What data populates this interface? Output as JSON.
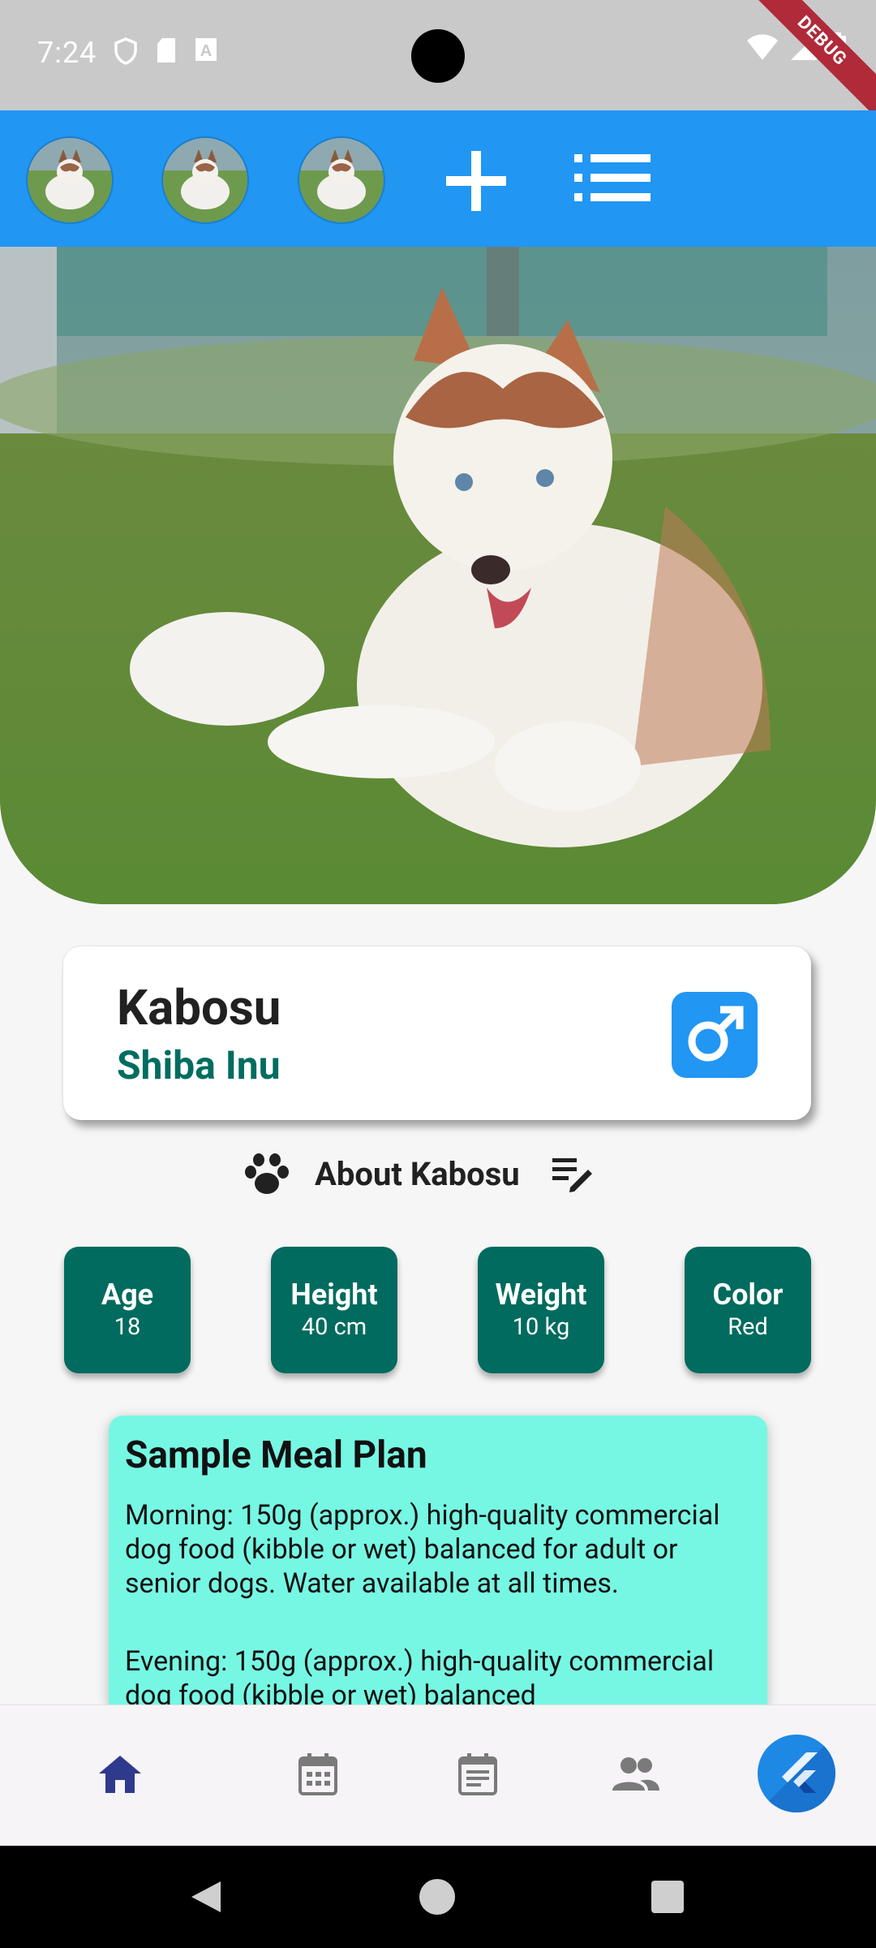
{
  "status_bar": {
    "time": "7:24",
    "debug_label": "DEBUG"
  },
  "top_bar": {
    "avatars": [
      "pet-avatar-1",
      "pet-avatar-2",
      "pet-avatar-3"
    ],
    "icons": [
      "add-icon",
      "list-icon"
    ]
  },
  "pet": {
    "name": "Kabosu",
    "breed": "Shiba Inu",
    "gender_icon": "male-icon"
  },
  "about": {
    "label": "About Kabosu",
    "icons": [
      "paw-icon",
      "edit-notes-icon"
    ]
  },
  "stats": [
    {
      "label": "Age",
      "value": "18"
    },
    {
      "label": "Height",
      "value": "40 cm"
    },
    {
      "label": "Weight",
      "value": "10 kg"
    },
    {
      "label": "Color",
      "value": "Red"
    }
  ],
  "meal_plan": {
    "title": "Sample Meal Plan",
    "morning": "Morning: 150g (approx.) high-quality commercial dog food (kibble or wet) balanced for adult or senior dogs. Water available at all times.",
    "evening": "Evening: 150g (approx.) high-quality commercial dog food (kibble or wet) balanced"
  },
  "bottom_nav": {
    "items": [
      "home-icon",
      "calendar-icon",
      "event-note-icon",
      "people-icon",
      "flutter-logo"
    ],
    "active": "home-icon",
    "colors": {
      "active": "#2e3a8c",
      "inactive": "#7a7a7a"
    }
  },
  "colors": {
    "app_bar": "#2196f3",
    "breed_text": "#006d60",
    "stat_box": "#006b5e",
    "meal_card": "#76f7e4"
  }
}
